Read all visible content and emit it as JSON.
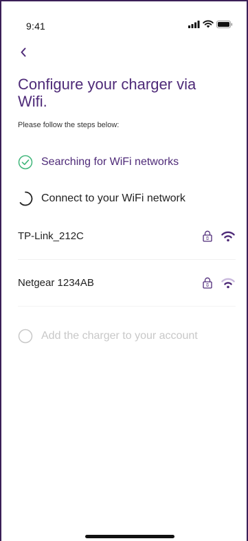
{
  "status_bar": {
    "time": "9:41"
  },
  "header": {
    "title": "Configure your charger via Wifi.",
    "subtitle": "Please follow the steps below:"
  },
  "steps": [
    {
      "label": "Searching for WiFi networks",
      "state": "done"
    },
    {
      "label": "Connect to your WiFi network",
      "state": "in-progress"
    },
    {
      "label": "Add the charger to your account",
      "state": "pending"
    }
  ],
  "networks": [
    {
      "name": "TP-Link_212C",
      "secured": true,
      "signal": "strong"
    },
    {
      "name": "Netgear 1234AB",
      "secured": true,
      "signal": "medium"
    }
  ],
  "colors": {
    "accent": "#4e2a78",
    "disabled": "#c8c8c8",
    "wifi_faded": "#c9b8dd"
  }
}
